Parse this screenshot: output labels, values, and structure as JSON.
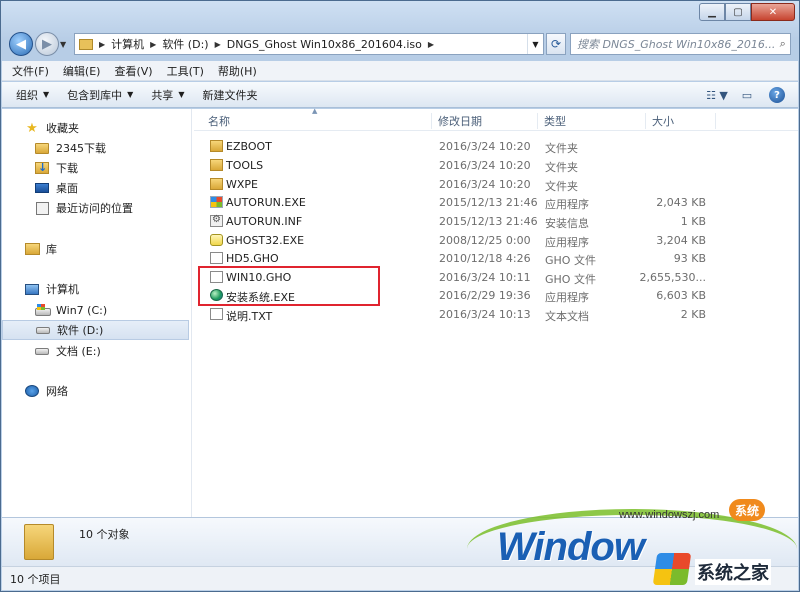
{
  "window": {
    "caption_min": "▁",
    "caption_max": "▢",
    "caption_close": "✕"
  },
  "address": {
    "crumbs": [
      "计算机",
      "软件 (D:)",
      "DNGS_Ghost Win10x86_201604.iso"
    ],
    "search_placeholder": "搜索 DNGS_Ghost Win10x86_2016..."
  },
  "menu": [
    "文件(F)",
    "编辑(E)",
    "查看(V)",
    "工具(T)",
    "帮助(H)"
  ],
  "toolbar": {
    "organize": "组织",
    "include_library": "包含到库中",
    "share": "共享",
    "new_folder": "新建文件夹"
  },
  "nav": {
    "favorites": "收藏夹",
    "fav_items": [
      "2345下载",
      "下载",
      "桌面",
      "最近访问的位置"
    ],
    "libraries": "库",
    "computer": "计算机",
    "drives": [
      "Win7 (C:)",
      "软件 (D:)",
      "文档 (E:)"
    ],
    "network": "网络"
  },
  "columns": {
    "name": "名称",
    "date": "修改日期",
    "type": "类型",
    "size": "大小"
  },
  "files": [
    {
      "name": "EZBOOT",
      "date": "2016/3/24 10:20",
      "type": "文件夹",
      "size": "",
      "icon": "folder"
    },
    {
      "name": "TOOLS",
      "date": "2016/3/24 10:20",
      "type": "文件夹",
      "size": "",
      "icon": "folder"
    },
    {
      "name": "WXPE",
      "date": "2016/3/24 10:20",
      "type": "文件夹",
      "size": "",
      "icon": "folder"
    },
    {
      "name": "AUTORUN.EXE",
      "date": "2015/12/13 21:46",
      "type": "应用程序",
      "size": "2,043 KB",
      "icon": "exe"
    },
    {
      "name": "AUTORUN.INF",
      "date": "2015/12/13 21:46",
      "type": "安装信息",
      "size": "1 KB",
      "icon": "inf"
    },
    {
      "name": "GHOST32.EXE",
      "date": "2008/12/25 0:00",
      "type": "应用程序",
      "size": "3,204 KB",
      "icon": "ghost"
    },
    {
      "name": "HD5.GHO",
      "date": "2010/12/18 4:26",
      "type": "GHO 文件",
      "size": "93 KB",
      "icon": "doc"
    },
    {
      "name": "WIN10.GHO",
      "date": "2016/3/24 10:11",
      "type": "GHO 文件",
      "size": "2,655,530...",
      "icon": "doc"
    },
    {
      "name": "安装系统.EXE",
      "date": "2016/2/29 19:36",
      "type": "应用程序",
      "size": "6,603 KB",
      "icon": "setup"
    },
    {
      "name": "说明.TXT",
      "date": "2016/3/24 10:13",
      "type": "文本文档",
      "size": "2 KB",
      "icon": "doc"
    }
  ],
  "details": {
    "count": "10 个对象"
  },
  "status": {
    "items": "10 个项目"
  },
  "watermark": {
    "url": "www.windowszj.com",
    "badge": "系统",
    "brand": "Window",
    "sys_text": "系统之家"
  },
  "colors": {
    "highlight": "#e0242f",
    "accent": "#1a5fb4"
  }
}
